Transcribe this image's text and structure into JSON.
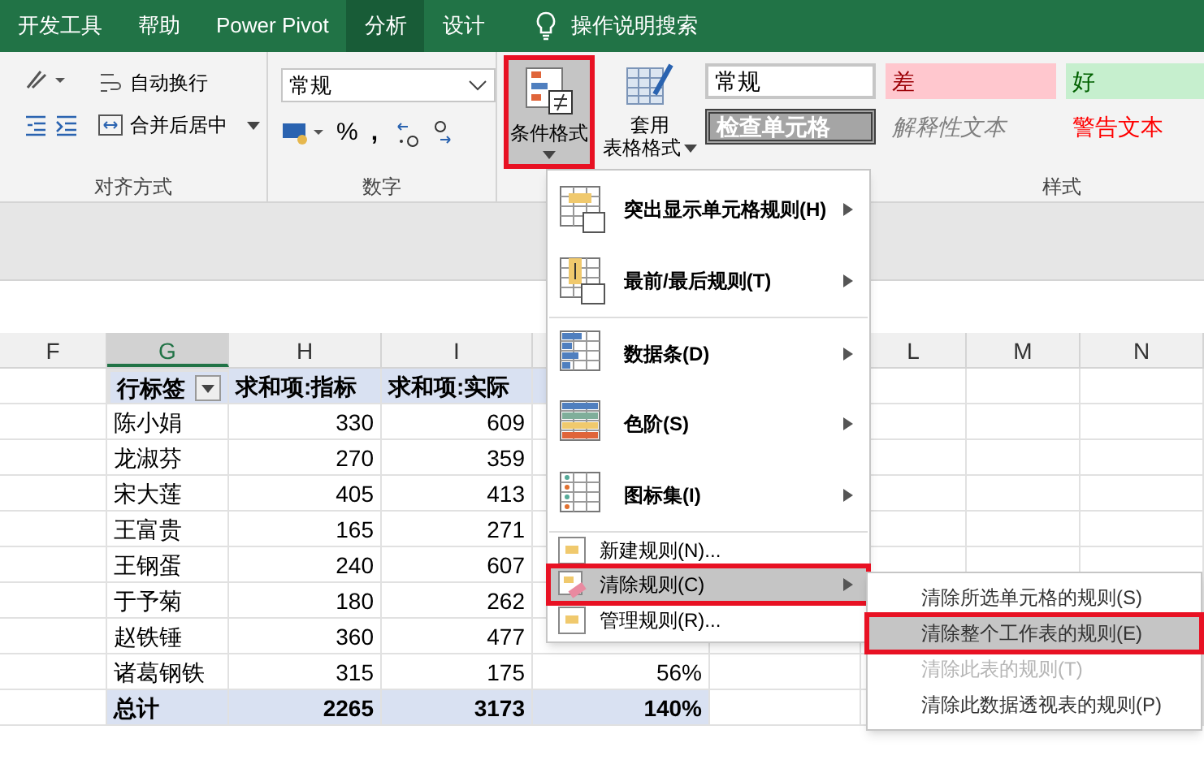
{
  "ribbon_tabs": [
    {
      "label": "开发工具",
      "selected": false
    },
    {
      "label": "帮助",
      "selected": false
    },
    {
      "label": "Power Pivot",
      "selected": false
    },
    {
      "label": "分析",
      "selected": true
    },
    {
      "label": "设计",
      "selected": false
    }
  ],
  "tell_me": "操作说明搜索",
  "alignment_group": {
    "wrap_text": "自动换行",
    "merge_center": "合并后居中",
    "label": "对齐方式"
  },
  "number_group": {
    "format": "常规",
    "percent": "%",
    "comma": ",",
    "label": "数字"
  },
  "styles_group": {
    "conditional_formatting": {
      "label": "条件格式",
      "selected": true
    },
    "format_as_table": [
      "套用",
      "表格格式"
    ],
    "styles": [
      {
        "label": "常规",
        "kind": "normal"
      },
      {
        "label": "差",
        "kind": "bad"
      },
      {
        "label": "好",
        "kind": "good"
      },
      {
        "label": "检查单元格",
        "kind": "check"
      },
      {
        "label": "解释性文本",
        "kind": "explanatory"
      },
      {
        "label": "警告文本",
        "kind": "warning"
      }
    ],
    "label": "样式"
  },
  "columns": [
    {
      "label": "F",
      "selected": false
    },
    {
      "label": "G",
      "selected": true
    },
    {
      "label": "H",
      "selected": false
    },
    {
      "label": "I",
      "selected": false
    },
    {
      "label": "L",
      "selected": false
    },
    {
      "label": "M",
      "selected": false
    },
    {
      "label": "N",
      "selected": false
    }
  ],
  "pivot": {
    "headers": [
      "行标签",
      "求和项:指标",
      "求和项:实际"
    ],
    "rows": [
      {
        "name": "陈小娟",
        "target": "330",
        "actual": "609",
        "rate": ""
      },
      {
        "name": "龙淑芬",
        "target": "270",
        "actual": "359",
        "rate": ""
      },
      {
        "name": "宋大莲",
        "target": "405",
        "actual": "413",
        "rate": ""
      },
      {
        "name": "王富贵",
        "target": "165",
        "actual": "271",
        "rate": ""
      },
      {
        "name": "王钢蛋",
        "target": "240",
        "actual": "607",
        "rate": ""
      },
      {
        "name": "于予菊",
        "target": "180",
        "actual": "262",
        "rate": ""
      },
      {
        "name": "赵铁锤",
        "target": "360",
        "actual": "477",
        "rate": ""
      },
      {
        "name": "诸葛钢铁",
        "target": "315",
        "actual": "175",
        "rate": "56%"
      }
    ],
    "total": {
      "name": "总计",
      "target": "2265",
      "actual": "3173",
      "rate": "140%"
    }
  },
  "menu": {
    "items": [
      {
        "label": "突出显示单元格规则(H)",
        "kind": "big",
        "submenu": true,
        "selected": false,
        "disabled": false
      },
      {
        "label": "最前/最后规则(T)",
        "kind": "big",
        "submenu": true,
        "selected": false,
        "disabled": false
      },
      {
        "label": "数据条(D)",
        "kind": "big",
        "submenu": true,
        "selected": false,
        "disabled": false
      },
      {
        "label": "色阶(S)",
        "kind": "big",
        "submenu": true,
        "selected": false,
        "disabled": false
      },
      {
        "label": "图标集(I)",
        "kind": "big",
        "submenu": true,
        "selected": false,
        "disabled": false
      },
      {
        "label": "新建规则(N)...",
        "kind": "small",
        "submenu": false,
        "selected": false,
        "disabled": false
      },
      {
        "label": "清除规则(C)",
        "kind": "small",
        "submenu": true,
        "selected": true,
        "disabled": false
      },
      {
        "label": "管理规则(R)...",
        "kind": "small",
        "submenu": false,
        "selected": false,
        "disabled": false
      }
    ]
  },
  "submenu": {
    "items": [
      {
        "label": "清除所选单元格的规则(S)",
        "selected": false,
        "disabled": false
      },
      {
        "label": "清除整个工作表的规则(E)",
        "selected": true,
        "disabled": false
      },
      {
        "label": "清除此表的规则(T)",
        "selected": false,
        "disabled": true
      },
      {
        "label": "清除此数据透视表的规则(P)",
        "selected": false,
        "disabled": false
      }
    ]
  }
}
